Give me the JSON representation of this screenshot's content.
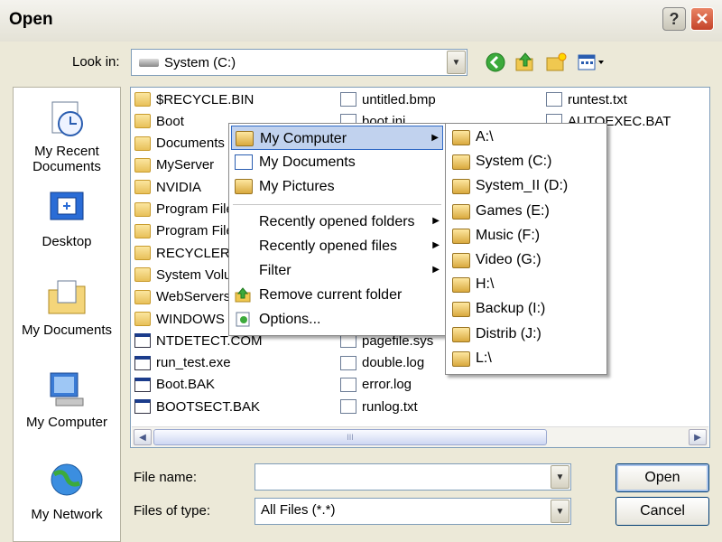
{
  "dialog": {
    "title": "Open",
    "help": "?",
    "close": "✕"
  },
  "look_in": {
    "label": "Look in:",
    "value": "System (C:)"
  },
  "places": [
    {
      "label": "My Recent Documents",
      "icon": "recent-documents-icon"
    },
    {
      "label": "Desktop",
      "icon": "desktop-icon"
    },
    {
      "label": "My Documents",
      "icon": "my-documents-icon"
    },
    {
      "label": "My Computer",
      "icon": "my-computer-icon"
    },
    {
      "label": "My Network",
      "icon": "my-network-icon"
    }
  ],
  "files": {
    "col1": [
      "$RECYCLE.BIN",
      "Boot",
      "Documents",
      "MyServer",
      "NVIDIA",
      "Program Files",
      "Program Files",
      "RECYCLER",
      "System Volume",
      "WebServers",
      "WINDOWS",
      "NTDETECT.COM",
      "run_test.exe",
      "Boot.BAK",
      "BOOTSECT.BAK"
    ],
    "col2": [
      "untitled.bmp",
      "boot.ini",
      "",
      "",
      "",
      "",
      "",
      "",
      "",
      "",
      "",
      "pagefile.sys",
      "double.log",
      "error.log",
      "runlog.txt"
    ],
    "col3": [
      "runtest.txt",
      "AUTOEXEC.BAT"
    ]
  },
  "hscroll": {
    "thumb_grip": "III"
  },
  "file_name": {
    "label": "File name:",
    "value": ""
  },
  "file_type": {
    "label": "Files of type:",
    "value": "All Files (*.*)"
  },
  "buttons": {
    "open": "Open",
    "cancel": "Cancel"
  },
  "context_menu": {
    "items": [
      "My Computer",
      "My Documents",
      "My Pictures",
      "Recently opened folders",
      "Recently opened files",
      "Filter",
      "Remove current folder",
      "Options..."
    ]
  },
  "submenu": {
    "drives": [
      "A:\\",
      "System (C:)",
      "System_II (D:)",
      "Games (E:)",
      "Music (F:)",
      "Video (G:)",
      "H:\\",
      "Backup (I:)",
      "Distrib (J:)",
      "L:\\"
    ]
  },
  "colors": {
    "highlight": "#c1d2ee",
    "highlight_border": "#316ac5",
    "dialog_bg": "#ece9d8"
  }
}
